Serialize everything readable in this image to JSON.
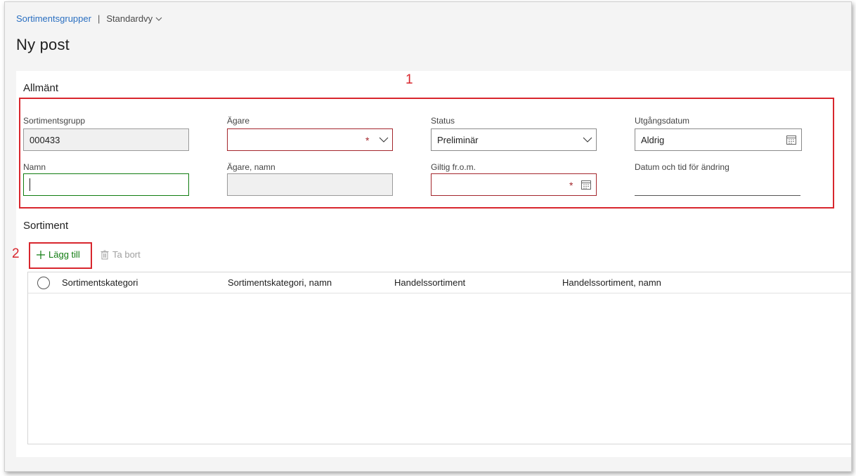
{
  "breadcrumb": {
    "link": "Sortimentsgrupper",
    "separator": "|",
    "view": "Standardvy"
  },
  "page_title": "Ny post",
  "general": {
    "title": "Allmänt",
    "fields": {
      "assortment_group": {
        "label": "Sortimentsgrupp",
        "value": "000433"
      },
      "owner": {
        "label": "Ägare",
        "value": ""
      },
      "status": {
        "label": "Status",
        "value": "Preliminär"
      },
      "expiration": {
        "label": "Utgångsdatum",
        "value": "Aldrig"
      },
      "name": {
        "label": "Namn",
        "value": ""
      },
      "owner_name": {
        "label": "Ägare, namn",
        "value": ""
      },
      "valid_from": {
        "label": "Giltig fr.o.m.",
        "value": ""
      },
      "modified": {
        "label": "Datum och tid för ändring",
        "value": ""
      }
    },
    "required_marker": "*"
  },
  "assortment": {
    "title": "Sortiment",
    "toolbar": {
      "add_label": "Lägg till",
      "delete_label": "Ta bort"
    },
    "columns": [
      "Sortimentskategori",
      "Sortimentskategori, namn",
      "Handelssortiment",
      "Handelssortiment, namn"
    ],
    "rows": []
  },
  "annotations": {
    "one": "1",
    "two": "2"
  },
  "colors": {
    "link": "#2a6fc1",
    "required_border": "#a4262c",
    "focus_border": "#107c10",
    "add_green": "#107c10",
    "annotation_red": "#d8262d"
  },
  "icons": [
    "chevron-down-icon",
    "calendar-icon",
    "plus-icon",
    "trash-icon"
  ]
}
